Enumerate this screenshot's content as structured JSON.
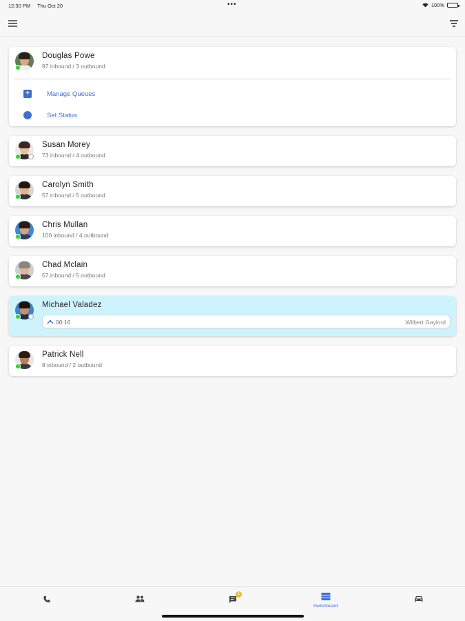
{
  "status_bar": {
    "time": "12:30 PM",
    "date": "Thu Oct 20",
    "dots": "•••",
    "battery": "100%"
  },
  "colors": {
    "accent": "#3d6fd3",
    "online": "#2bd52b",
    "active_card": "#cff3fd",
    "badge": "#f2b82d"
  },
  "toolbar": {
    "menu_icon": "menu-icon",
    "filter_icon": "filter-icon"
  },
  "current_agent": {
    "name": "Douglas Powe",
    "stats": "97 inbound / 3 outbound",
    "actions": [
      {
        "label": "Manage Queues",
        "icon": "queue-icon"
      },
      {
        "label": "Set Status",
        "icon": "status-dot-icon"
      }
    ]
  },
  "agents": [
    {
      "name": "Susan Morey",
      "stats": "73 inbound / 4 outbound"
    },
    {
      "name": "Carolyn Smith",
      "stats": "57 inbound / 5 outbound"
    },
    {
      "name": "Chris Mullan",
      "stats": "100 inbound / 4 outbound"
    },
    {
      "name": "Chad Mclain",
      "stats": "57 inbound / 5 outbound"
    },
    {
      "name": "Michael Valadez",
      "call": {
        "duration": "00:16",
        "caller": "Wilbert Gaylord"
      }
    },
    {
      "name": "Patrick Nell",
      "stats": "8 inbound / 2 outbound"
    }
  ],
  "tabs": [
    {
      "icon": "phone-icon",
      "label": ""
    },
    {
      "icon": "people-icon",
      "label": ""
    },
    {
      "icon": "chat-icon",
      "label": "",
      "badge": "1"
    },
    {
      "icon": "switchboard-icon",
      "label": "Switchboard"
    },
    {
      "icon": "car-icon",
      "label": ""
    }
  ]
}
